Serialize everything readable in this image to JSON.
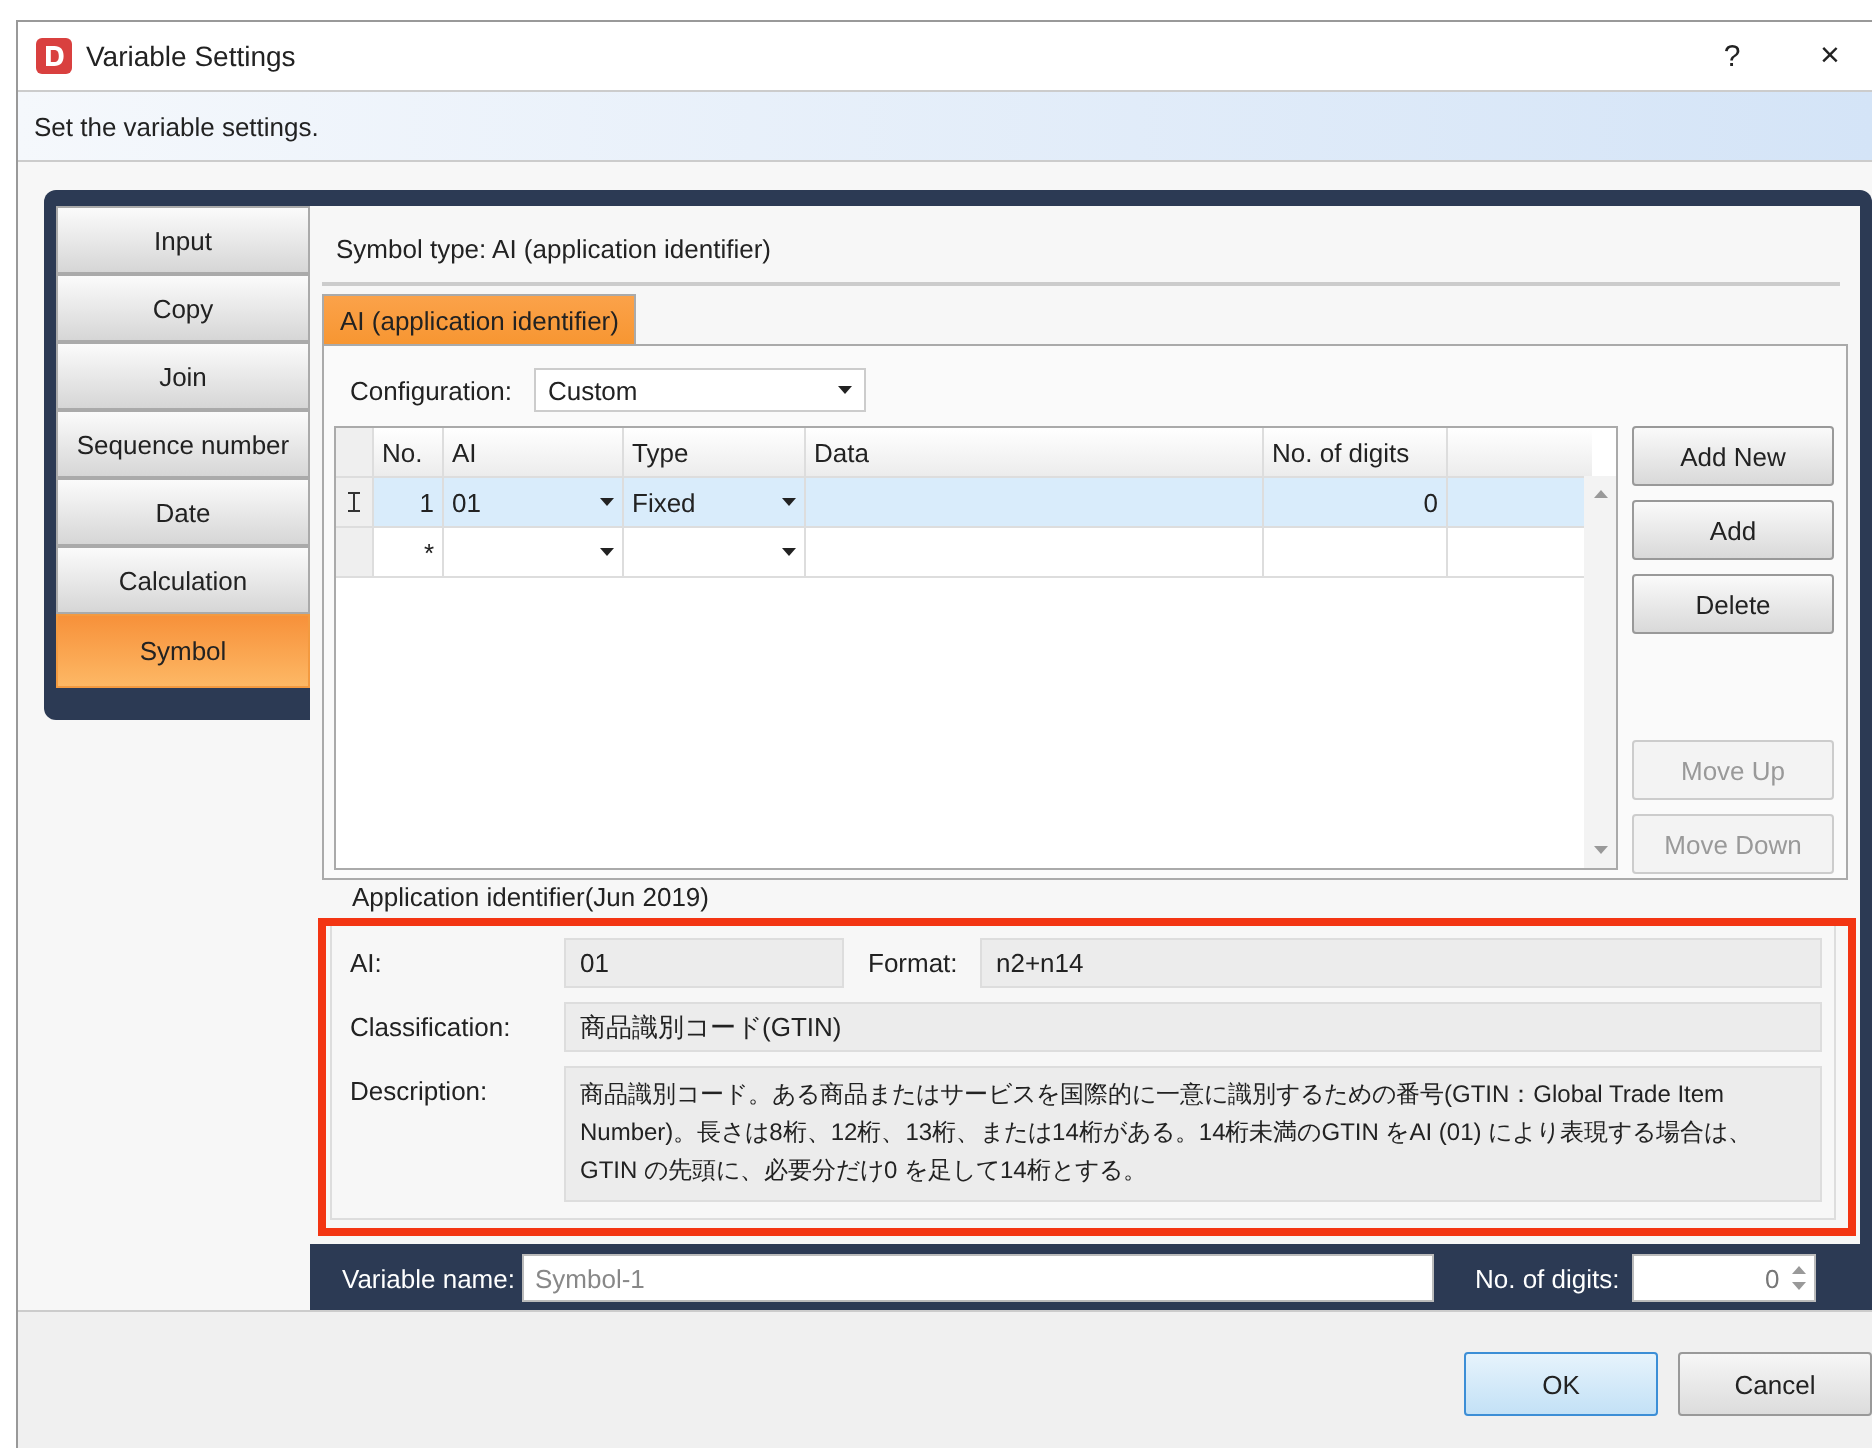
{
  "window": {
    "title": "Variable Settings",
    "help_button": "?",
    "close_button": "×"
  },
  "instruction": "Set the variable settings.",
  "sidebar": {
    "items": [
      {
        "label": "Input",
        "selected": false
      },
      {
        "label": "Copy",
        "selected": false
      },
      {
        "label": "Join",
        "selected": false
      },
      {
        "label": "Sequence number",
        "selected": false
      },
      {
        "label": "Date",
        "selected": false
      },
      {
        "label": "Calculation",
        "selected": false
      },
      {
        "label": "Symbol",
        "selected": true
      }
    ]
  },
  "symbol_type": "Symbol type: AI (application identifier)",
  "tabs": [
    {
      "label": "AI (application identifier)",
      "selected": true
    }
  ],
  "configuration": {
    "label": "Configuration:",
    "value": "Custom"
  },
  "table": {
    "columns": [
      "No.",
      "AI",
      "Type",
      "Data",
      "No. of digits"
    ],
    "rows": [
      {
        "no": "1",
        "ai": "01",
        "type": "Fixed",
        "digits": "0",
        "selected": true,
        "current": true
      },
      {
        "no": "*",
        "selected": false,
        "current": false
      }
    ]
  },
  "buttons": [
    {
      "label": "Add New",
      "disabled": false
    },
    {
      "label": "Add",
      "disabled": false
    },
    {
      "label": "Delete",
      "disabled": false
    },
    {
      "label": "Move Up",
      "disabled": true
    },
    {
      "label": "Move Down",
      "disabled": true
    }
  ],
  "ai_info": {
    "legend": "Application identifier(Jun 2019)",
    "ai_label": "AI:",
    "ai": "01",
    "format_label": "Format:",
    "format": "n2+n14",
    "classification_label": "Classification:",
    "classification": "商品識別コード(GTIN)",
    "description_label": "Description:",
    "description": "商品識別コード。ある商品またはサービスを国際的に一意に識別するための番号(GTIN：Global Trade Item Number)。長さは8桁、12桁、13桁、または14桁がある。14桁未満のGTIN をAI (01) により表現する場合は、GTIN の先頭に、必要分だけ0 を足して14桁とする。"
  },
  "variable": {
    "name_label": "Variable name:",
    "name_placeholder": "Symbol-1",
    "digits_label": "No. of digits:",
    "digits": "0"
  },
  "footer_buttons": [
    {
      "label": "OK",
      "default": true
    },
    {
      "label": "Cancel",
      "default": false
    }
  ]
}
